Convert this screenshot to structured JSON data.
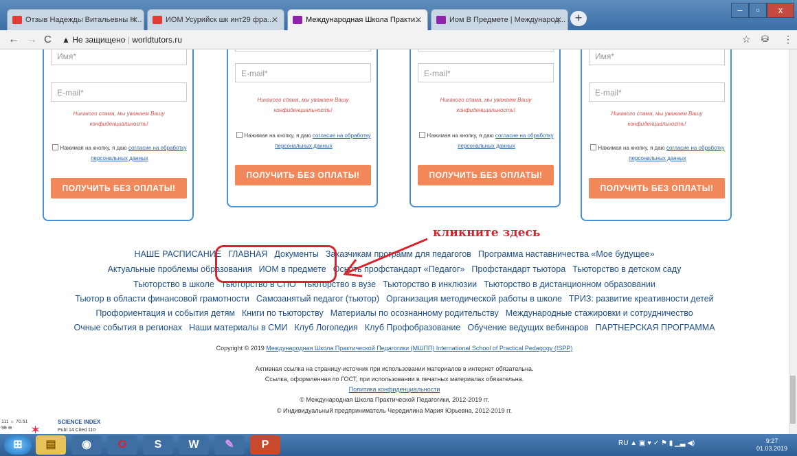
{
  "browser": {
    "tabs": [
      {
        "title": "Отзыв Надежды Витальевны Н...",
        "color": "#e53935"
      },
      {
        "title": "ИОМ Усурийск шк инт29 фра...",
        "color": "#e53935"
      },
      {
        "title": "Международная Школа Практи...",
        "color": "#8e24aa"
      },
      {
        "title": "Иом В Предмете | Международ...",
        "color": "#8e24aa"
      }
    ],
    "new_tab": "+",
    "security": "Не защищено",
    "url": "worldtutors.ru",
    "win_controls": [
      "–",
      "▫",
      "x"
    ]
  },
  "forms": {
    "name_placeholder": "Имя*",
    "email_placeholder": "E-mail*",
    "spam_note": "Никакого спама, мы уважаем Вашу конфиденциальность!",
    "consent_text": "Нажимая на кнопку, я даю",
    "consent_link": "согласие на обработку персональных данных",
    "submit": "ПОЛУЧИТЬ БЕЗ ОПЛАТЫ!"
  },
  "annotation": {
    "text": "кликните здесь",
    "color": "#d6242f"
  },
  "links": {
    "row1": [
      "НАШЕ РАСПИСАНИЕ",
      "ГЛАВНАЯ",
      "Документы",
      "Заказчикам программ для педагогов",
      "Программа наставничества «Мое будущее»"
    ],
    "row2": [
      "Актуальные проблемы образования",
      "ИОМ в предмете",
      "Осноть профстандарт «Педагог»",
      "Профстандарт тьютора",
      "Тьюторство в детском саду"
    ],
    "row3": [
      "Тьюторство в школе",
      "Тьюторство в СПО",
      "Тьюторство в вузе",
      "Тьюторство в инклюзии",
      "Тьюторство в дистанционном образовании"
    ],
    "row4": [
      "Тьютор в области финансовой грамотности",
      "Самозанятый педагог (тьютор)",
      "Организация методической работы в школе",
      "ТРИЗ: развитие креативности детей"
    ],
    "row5": [
      "Профориентация и события детям",
      "Книги по тьюторству",
      "Материалы по осознанному родительству",
      "Международные стажировки и сотрудничество"
    ],
    "row6": [
      "Очные события в регионах",
      "Наши материалы в СМИ",
      "Клуб Логопедия",
      "Клуб Профобразование",
      "Обучение ведущих вебинаров",
      "ПАРТНЕРСКАЯ ПРОГРАММА"
    ]
  },
  "footer": {
    "copyright_prefix": "Copyright © 2019",
    "copyright_link": "Международная Школа Практической Педагогики (МШПП) International School of Practical Pedagogy (ISPP)",
    "line1": "Активная ссылка на страницу-источник при использовании материалов в интернет обязательна.",
    "line2": "Ссылка, оформленная по ГОСТ, при использовании в печатных материалах обязательна.",
    "privacy": "Политика конфиденциальности",
    "line3": "© Международная Школа Практической Педагогики, 2012-2019 гг.",
    "line4": "© Индивидуальный предприниматель Чередилина Мария Юрьевна, 2012-2019 гг."
  },
  "badge": {
    "title": "SCIENCE INDEX",
    "nums": "111 ☼ 70.51 98 ⊕",
    "sub": "Publ 14 Cited 110"
  },
  "taskbar": {
    "lang": "RU",
    "time": "9:27",
    "date": "01.03.2019"
  }
}
